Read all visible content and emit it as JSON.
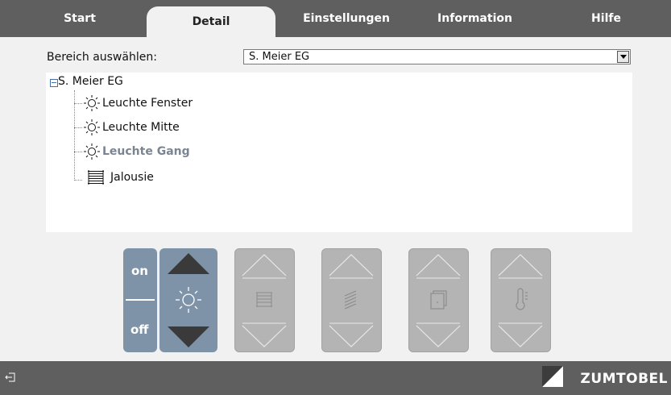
{
  "tabs": [
    {
      "label": "Start",
      "active": false
    },
    {
      "label": "Detail",
      "active": true
    },
    {
      "label": "Einstellungen",
      "active": false
    },
    {
      "label": "Information",
      "active": false
    },
    {
      "label": "Hilfe",
      "active": false
    }
  ],
  "area": {
    "label": "Bereich auswählen:",
    "selected": "S. Meier EG"
  },
  "tree": {
    "root": "S. Meier EG",
    "items": [
      {
        "label": "Leuchte Fenster",
        "icon": "sun-icon",
        "selected": false
      },
      {
        "label": "Leuchte Mitte",
        "icon": "sun-icon",
        "selected": false
      },
      {
        "label": "Leuchte Gang",
        "icon": "sun-icon",
        "selected": true
      },
      {
        "label": "Jalousie",
        "icon": "blinds-icon",
        "selected": false
      }
    ]
  },
  "controls": {
    "on_label": "on",
    "off_label": "off",
    "groups": [
      {
        "icon": "light-icon",
        "enabled": true
      },
      {
        "icon": "blinds-icon",
        "enabled": false
      },
      {
        "icon": "slats-icon",
        "enabled": false
      },
      {
        "icon": "window-icon",
        "enabled": false
      },
      {
        "icon": "thermometer-icon",
        "enabled": false
      }
    ]
  },
  "footer": {
    "brand": "ZUMTOBEL",
    "exit_icon": "exit-icon"
  },
  "colors": {
    "bar": "#5f5f5f",
    "panel": "#f1f1f1",
    "active_control": "#7e93a8",
    "disabled_control": "#b4b4b4",
    "selected_item": "#7b8592"
  }
}
